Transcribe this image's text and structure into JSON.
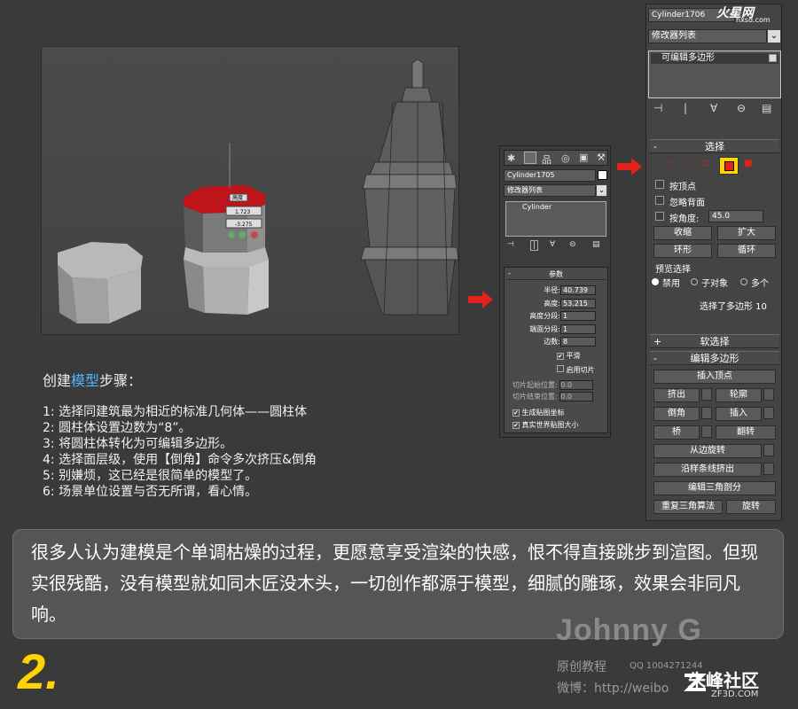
{
  "steps": {
    "title_pre": "创建",
    "title_hl": "模型",
    "title_post": "步骤：",
    "items": [
      "1: 选择同建筑最为相近的标准几何体——圆柱体",
      "2: 圆柱体设置边数为“8”。",
      "3: 将圆柱体转化为可编辑多边形。",
      "4: 选择面层级，使用【倒角】命令多次挤压&倒角",
      "5: 别嫌烦，这已经是很简单的模型了。",
      "6: 场景单位设置与否无所谓，看心情。"
    ]
  },
  "quote": "很多人认为建模是个单调枯燥的过程，更愿意享受渲染的快感，恨不得直接跳步到渲图。但现实很残酷，没有模型就如同木匠没木头，一切创作都源于模型，细腻的雕琢，效果会非同凡响。",
  "page_number": "2.",
  "viewport": {
    "height_label": "高度",
    "spinner1": "1.723",
    "spinner2": "-3.275"
  },
  "small_panel": {
    "object_name": "Cylinder1705",
    "modifier_list": "修改器列表",
    "stack_item": "Cylinder",
    "params_head": "参数",
    "params": [
      {
        "label": "半径:",
        "value": "40.739"
      },
      {
        "label": "高度:",
        "value": "53.215"
      },
      {
        "label": "高度分段:",
        "value": "1"
      },
      {
        "label": "端面分段:",
        "value": "1"
      },
      {
        "label": "边数:",
        "value": "8"
      }
    ],
    "smooth": "平滑",
    "slice_on": "启用切片",
    "slice_from": "切片起始位置:",
    "slice_to": "切片结束位置:",
    "slice_from_val": "0.0",
    "slice_to_val": "0.0",
    "gen_map": "生成贴图坐标",
    "real_world": "真实世界贴图大小"
  },
  "big_panel": {
    "object_name": "Cylinder1706",
    "modifier_list": "修改器列表",
    "stack_item": "可编辑多边形",
    "select_head": "选择",
    "by_vertex": "按顶点",
    "ignore_back": "忽略背面",
    "by_angle": "按角度:",
    "angle_value": "45.0",
    "shrink": "收缩",
    "grow": "扩大",
    "ring": "环形",
    "loop": "循环",
    "preview_select": "预览选择",
    "disabled": "禁用",
    "subobject": "子对象",
    "multi": "多个",
    "selected_info": "选择了多边形 10",
    "soft_select": "软选择",
    "edit_poly": "编辑多边形",
    "insert_vertex": "插入顶点",
    "extrude": "挤出",
    "outline": "轮廓",
    "bevel": "倒角",
    "inset": "插入",
    "bridge": "桥",
    "flip": "翻转",
    "hinge": "从边旋转",
    "extrude_spline": "沿样条线挤出",
    "edit_tri": "编辑三角剖分",
    "retriangulate": "重复三角算法",
    "turn": "旋转"
  },
  "signature": {
    "name": "Johnny G",
    "sub": "原创教程",
    "qq": "QQ 1004271244",
    "weibo": "微博：http://weibo"
  },
  "logos": {
    "hxsd": "火星网",
    "hxsd_url": "hxsd.com",
    "zf": "朱峰社区",
    "zf_url": "ZF3D.COM"
  },
  "colors": {
    "accent_red": "#e2231a",
    "highlight_blue": "#4fb4ff",
    "number_yellow": "#ffd400",
    "selected_face": "#b3121a"
  }
}
